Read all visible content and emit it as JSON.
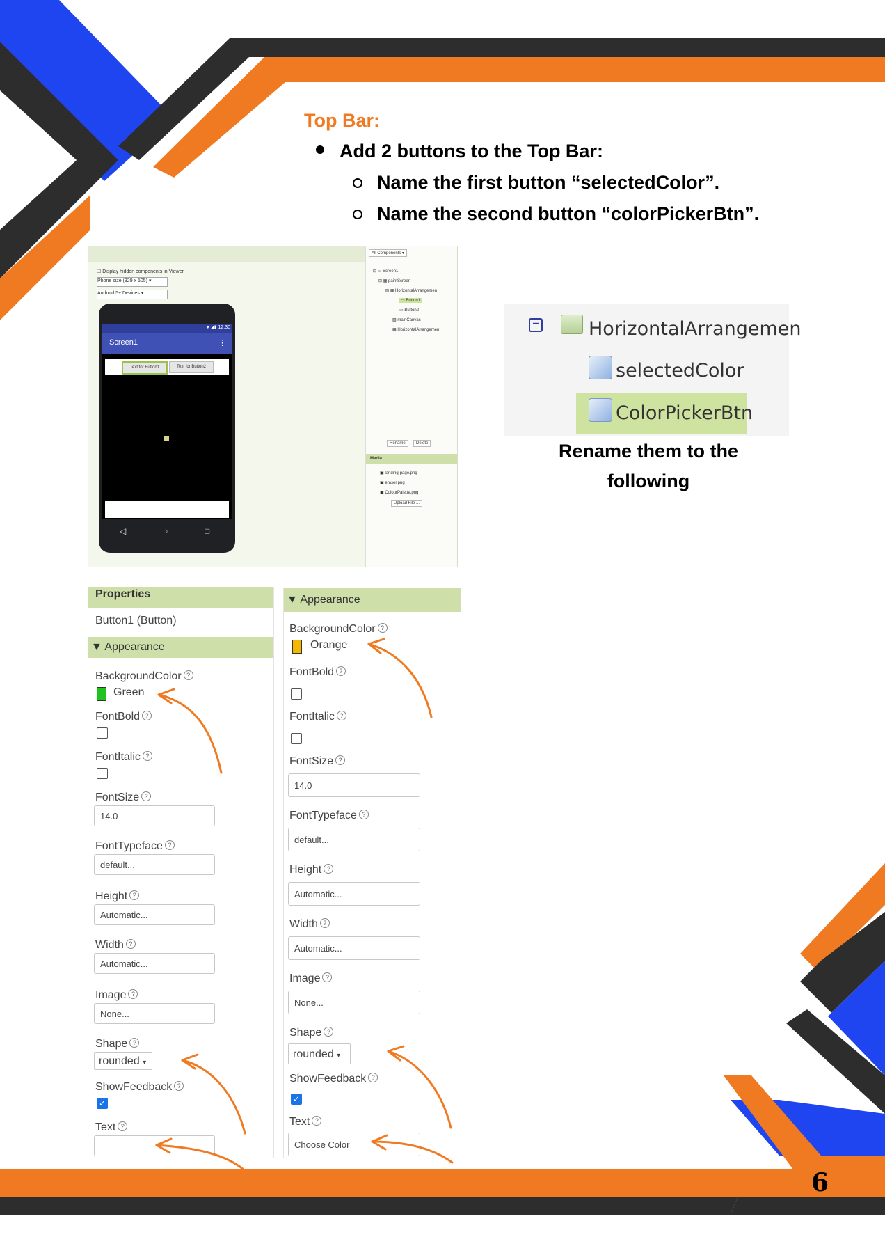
{
  "colors": {
    "orange": "#ef7a22",
    "blue": "#1f45f0",
    "dark": "#2d2d2d",
    "panel_head": "#cfdfaa"
  },
  "heading": "Top Bar:",
  "bullet": "Add 2 buttons to the Top Bar:",
  "sub_items": [
    "Name the first button “selectedColor”.",
    "Name the second button “colorPickerBtn”."
  ],
  "designer": {
    "checkbox_label": "Display hidden components in Viewer",
    "phone_size": "Phone size (329 x 505)",
    "android": "Android 5+ Devices",
    "time": "12:30",
    "screen_title": "Screen1",
    "btn1": "Text for Button1",
    "btn2": "Text for Button2",
    "components_dropdown": "All Components",
    "tree": [
      "Screen1",
      "paintScreen",
      "HorizontalArrangemen",
      "Button1",
      "Button2",
      "mainCanvas",
      "HorizontalArrangemen"
    ],
    "rename": "Rename",
    "delete": "Delete",
    "media_title": "Media",
    "media": [
      "landing-page.png",
      "eraser.png",
      "ColourPalette.png"
    ],
    "upload": "Upload File ..."
  },
  "tree_image": {
    "parent": "HorizontalArrangemen",
    "child1": "selectedColor",
    "child2": "ColorPickerBtn"
  },
  "caption_lines": [
    "Rename them to the",
    "following"
  ],
  "props_left": {
    "title": "Properties",
    "component": "Button1 (Button)",
    "appearance": "Appearance",
    "bg_label": "BackgroundColor",
    "bg_value": "Green",
    "bg_color": "#1ec31e",
    "fontbold": "FontBold",
    "fontitalic": "FontItalic",
    "fontsize": "FontSize",
    "fontsize_value": "14.0",
    "fonttypeface": "FontTypeface",
    "fonttypeface_value": "default...",
    "height": "Height",
    "height_value": "Automatic...",
    "width": "Width",
    "width_value": "Automatic...",
    "image": "Image",
    "image_value": "None...",
    "shape": "Shape",
    "shape_value": "rounded",
    "showfeedback": "ShowFeedback",
    "text": "Text",
    "text_value": ""
  },
  "props_right": {
    "appearance": "Appearance",
    "bg_label": "BackgroundColor",
    "bg_value": "Orange",
    "bg_color": "#f5b800",
    "fontbold": "FontBold",
    "fontitalic": "FontItalic",
    "fontsize": "FontSize",
    "fontsize_value": "14.0",
    "fonttypeface": "FontTypeface",
    "fonttypeface_value": "default...",
    "height": "Height",
    "height_value": "Automatic...",
    "width": "Width",
    "width_value": "Automatic...",
    "image": "Image",
    "image_value": "None...",
    "shape": "Shape",
    "shape_value": "rounded",
    "showfeedback": "ShowFeedback",
    "text": "Text",
    "text_value": "Choose Color"
  },
  "page_number": "6"
}
